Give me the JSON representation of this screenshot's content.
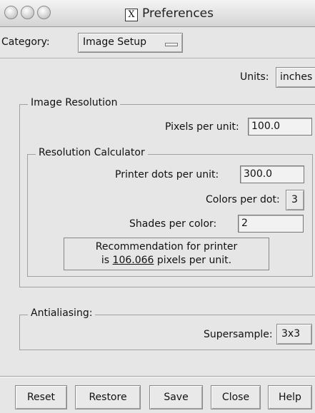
{
  "window": {
    "title": "Preferences",
    "app_icon_glyph": "X"
  },
  "category": {
    "label": "Category:",
    "selected": "Image Setup"
  },
  "units": {
    "label": "Units:",
    "value": "inches"
  },
  "image_resolution": {
    "group_title": "Image Resolution",
    "pixels_per_unit_label": "Pixels per unit:",
    "pixels_per_unit_value": "100.0"
  },
  "calculator": {
    "group_title": "Resolution Calculator",
    "printer_dots_label": "Printer dots per unit:",
    "printer_dots_value": "300.0",
    "colors_per_dot_label": "Colors per dot:",
    "colors_per_dot_value": "3",
    "shades_label": "Shades per color:",
    "shades_value": "2",
    "recommendation_line1": "Recommendation for printer",
    "recommendation_prefix": "is",
    "recommendation_value": "106.066",
    "recommendation_suffix": "pixels per unit."
  },
  "antialiasing": {
    "group_title": "Antialiasing:",
    "supersample_label": "Supersample:",
    "supersample_value": "3x3"
  },
  "buttons": {
    "reset": "Reset",
    "restore": "Restore",
    "save": "Save",
    "close": "Close",
    "help": "Help"
  }
}
